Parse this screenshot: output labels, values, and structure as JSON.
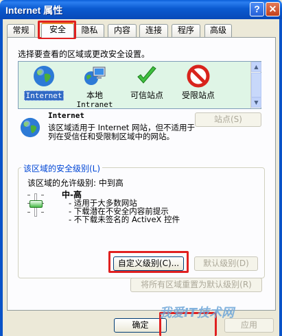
{
  "window": {
    "title": "Internet 属性",
    "help_label": "?",
    "close_label": "✕"
  },
  "tabs": [
    {
      "label": "常规"
    },
    {
      "label": "安全"
    },
    {
      "label": "隐私"
    },
    {
      "label": "内容"
    },
    {
      "label": "连接"
    },
    {
      "label": "程序"
    },
    {
      "label": "高级"
    }
  ],
  "zones": {
    "heading": "选择要查看的区域或更改安全设置。",
    "items": [
      {
        "label": "Internet",
        "icon": "globe-icon",
        "selected": true
      },
      {
        "label": "本地",
        "sublabel": "Intranet",
        "icon": "local-intranet-icon"
      },
      {
        "label": "可信站点",
        "icon": "checkmark-icon"
      },
      {
        "label": "受限站点",
        "icon": "restricted-icon"
      }
    ]
  },
  "zone_info": {
    "title": "Internet",
    "description": "该区域适用于 Internet 网站，但不适用于列在受信任和受限制区域中的网站。",
    "sites_button": "站点(S)"
  },
  "security_level": {
    "legend": "该区域的安全级别(L)",
    "allowed_levels": "该区域的允许级别: 中到高",
    "level_name": "中-高",
    "bullets": [
      "- 适用于大多数网站",
      "- 下载潜在不安全内容前提示",
      "- 不下载未签名的 ActiveX 控件"
    ],
    "slider_level": 0.33,
    "custom_button": "自定义级别(C)...",
    "default_button": "默认级别(D)",
    "reset_all_button": "将所有区域重置为默认级别(R)"
  },
  "footer": {
    "ok_label": "确定",
    "apply_label": "应用"
  },
  "watermark": "我爱IT技术网",
  "colors": {
    "highlight": "#e02020",
    "zone_bg": "#dff5e6",
    "legend_blue": "#0046d5"
  }
}
